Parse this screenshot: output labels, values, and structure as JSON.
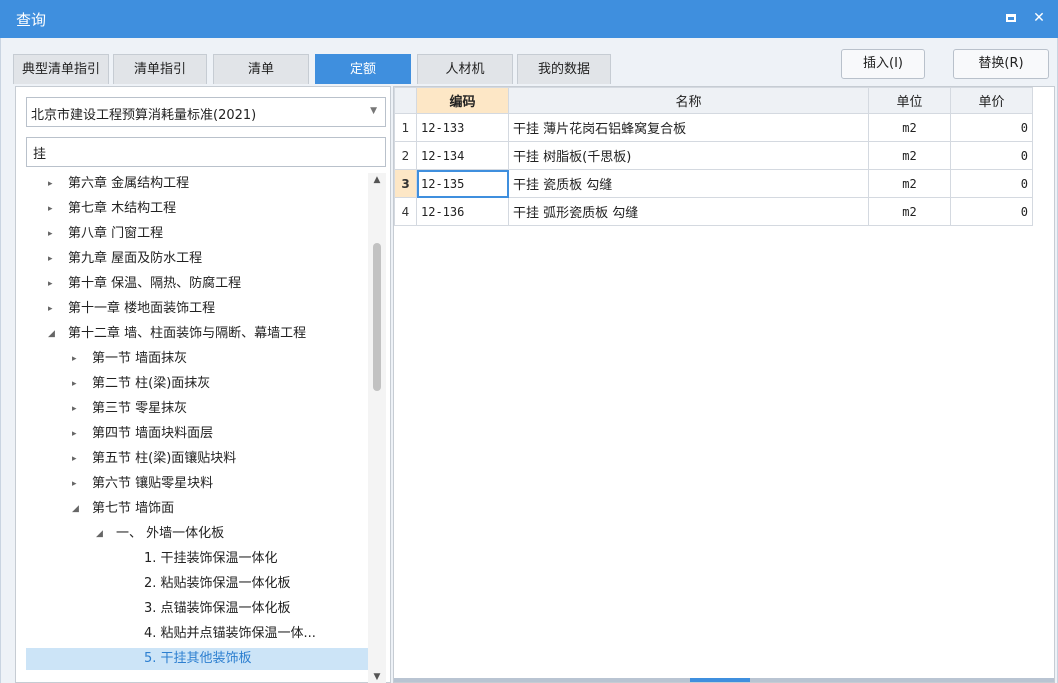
{
  "window": {
    "title": "查询"
  },
  "tabs": [
    {
      "label": "典型清单指引",
      "active": false
    },
    {
      "label": "清单指引",
      "active": false
    },
    {
      "label": "清单",
      "active": false
    },
    {
      "label": "定额",
      "active": true
    },
    {
      "label": "人材机",
      "active": false
    },
    {
      "label": "我的数据",
      "active": false
    }
  ],
  "actions": {
    "insert": "插入(I)",
    "replace": "替换(R)"
  },
  "left": {
    "standard_select": "北京市建设工程预算消耗量标准(2021)",
    "search_value": "挂",
    "tree": [
      {
        "label": "第六章 金属结构工程",
        "toggle": "▸"
      },
      {
        "label": "第七章 木结构工程",
        "toggle": "▸"
      },
      {
        "label": "第八章 门窗工程",
        "toggle": "▸"
      },
      {
        "label": "第九章 屋面及防水工程",
        "toggle": "▸"
      },
      {
        "label": "第十章 保温、隔热、防腐工程",
        "toggle": "▸"
      },
      {
        "label": "第十一章 楼地面装饰工程",
        "toggle": "▸"
      },
      {
        "label": "第十二章 墙、柱面装饰与隔断、幕墙工程",
        "toggle": "◢"
      },
      {
        "label": "第一节 墙面抹灰",
        "toggle": "▸"
      },
      {
        "label": "第二节 柱(梁)面抹灰",
        "toggle": "▸"
      },
      {
        "label": "第三节 零星抹灰",
        "toggle": "▸"
      },
      {
        "label": "第四节 墙面块料面层",
        "toggle": "▸"
      },
      {
        "label": "第五节 柱(梁)面镶贴块料",
        "toggle": "▸"
      },
      {
        "label": "第六节 镶贴零星块料",
        "toggle": "▸"
      },
      {
        "label": "第七节 墙饰面",
        "toggle": "◢"
      },
      {
        "label": "一、 外墙一体化板",
        "toggle": "◢"
      },
      {
        "label": "1. 干挂装饰保温一体化",
        "toggle": ""
      },
      {
        "label": "2. 粘贴装饰保温一体化板",
        "toggle": ""
      },
      {
        "label": "3. 点锚装饰保温一体化板",
        "toggle": ""
      },
      {
        "label": "4. 粘贴并点锚装饰保温一体...",
        "toggle": ""
      },
      {
        "label": "5. 干挂其他装饰板",
        "toggle": ""
      }
    ]
  },
  "grid": {
    "headers": {
      "code": "编码",
      "name": "名称",
      "unit": "单位",
      "price": "单价"
    },
    "rows": [
      {
        "idx": "1",
        "code": "12-133",
        "name": "干挂 薄片花岗石铝蜂窝复合板",
        "unit": "m2",
        "price": "0"
      },
      {
        "idx": "2",
        "code": "12-134",
        "name": "干挂 树脂板(千思板)",
        "unit": "m2",
        "price": "0"
      },
      {
        "idx": "3",
        "code": "12-135",
        "name": "干挂 瓷质板 勾缝",
        "unit": "m2",
        "price": "0"
      },
      {
        "idx": "4",
        "code": "12-136",
        "name": "干挂 弧形瓷质板 勾缝",
        "unit": "m2",
        "price": "0"
      }
    ]
  },
  "icons": {
    "maximize": "maximize-icon",
    "close": "close-icon",
    "dropdown": "chevron-down-icon"
  }
}
